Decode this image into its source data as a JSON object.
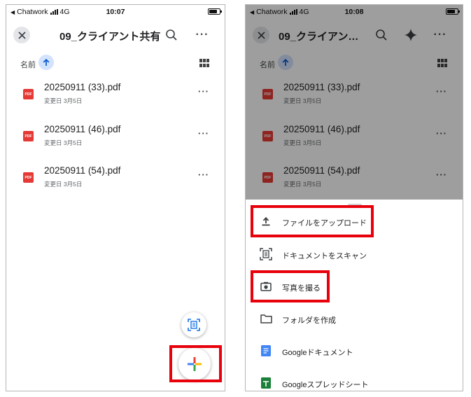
{
  "left_screen": {
    "status": {
      "carrier": "Chatwork",
      "network": "4G",
      "time": "10:07"
    },
    "title": "09_クライアント共有",
    "sort_label": "名前",
    "files": [
      {
        "name": "20250911 (33).pdf",
        "meta": "変更日 3月5日",
        "icon_text": "PDF"
      },
      {
        "name": "20250911 (46).pdf",
        "meta": "変更日 3月5日",
        "icon_text": "PDF"
      },
      {
        "name": "20250911 (54).pdf",
        "meta": "変更日 3月5日",
        "icon_text": "PDF"
      }
    ]
  },
  "right_screen": {
    "status": {
      "carrier": "Chatwork",
      "network": "4G",
      "time": "10:08"
    },
    "title": "09_クライアン…",
    "sort_label": "名前",
    "files": [
      {
        "name": "20250911 (33).pdf",
        "meta": "変更日 3月5日",
        "icon_text": "PDF"
      },
      {
        "name": "20250911 (46).pdf",
        "meta": "変更日 3月5日",
        "icon_text": "PDF"
      },
      {
        "name": "20250911 (54).pdf",
        "meta": "変更日 3月5日",
        "icon_text": "PDF"
      }
    ],
    "menu": [
      {
        "label": "ファイルをアップロード",
        "icon": "upload-icon"
      },
      {
        "label": "ドキュメントをスキャン",
        "icon": "scan-document-icon"
      },
      {
        "label": "写真を撮る",
        "icon": "camera-icon"
      },
      {
        "label": "フォルダを作成",
        "icon": "folder-icon"
      },
      {
        "label": "Googleドキュメント",
        "icon": "google-docs-icon"
      },
      {
        "label": "Googleスプレッドシート",
        "icon": "google-sheets-icon"
      }
    ]
  },
  "colors": {
    "highlight": "#e8000b",
    "pdf_red": "#e53935",
    "docs_blue": "#4285f4",
    "sheets_green": "#188038",
    "sort_chip": "#d3e3fd"
  }
}
